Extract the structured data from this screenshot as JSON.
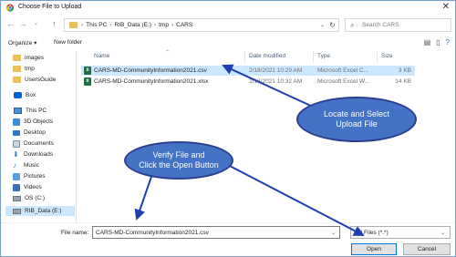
{
  "window": {
    "title": "Choose File to Upload",
    "close_glyph": "✕"
  },
  "address": {
    "crumbs": [
      "This PC",
      "RIB_Data (E:)",
      "tmp",
      "CARS"
    ],
    "separator": "›",
    "search_placeholder": "Search CARS"
  },
  "toolbar": {
    "organize_label": "Organize ▾",
    "new_folder_label": "New folder"
  },
  "nav": {
    "items": [
      {
        "label": "images",
        "icon": "folder-icon"
      },
      {
        "label": "tmp",
        "icon": "folder-icon"
      },
      {
        "label": "UsersGuide",
        "icon": "folder-icon"
      },
      {
        "label": "Box",
        "icon": "box-icon"
      },
      {
        "label": "This PC",
        "icon": "computer-icon"
      },
      {
        "label": "3D Objects",
        "icon": "3d-objects-icon"
      },
      {
        "label": "Desktop",
        "icon": "desktop-icon"
      },
      {
        "label": "Documents",
        "icon": "documents-icon"
      },
      {
        "label": "Downloads",
        "icon": "downloads-icon"
      },
      {
        "label": "Music",
        "icon": "music-icon"
      },
      {
        "label": "Pictures",
        "icon": "pictures-icon"
      },
      {
        "label": "Videos",
        "icon": "videos-icon"
      },
      {
        "label": "OS (C:)",
        "icon": "drive-icon"
      },
      {
        "label": "RIB_Data (E:)",
        "icon": "drive-icon"
      }
    ]
  },
  "files": {
    "columns": [
      "Name",
      "Date modified",
      "Type",
      "Size"
    ],
    "rows": [
      {
        "name": "CARS-MD-CommunityInformation2021.csv",
        "date": "2/18/2021 10:29 AM",
        "type": "Microsoft Excel C...",
        "size": "3 KB"
      },
      {
        "name": "CARS-MD-CommunityInformation2021.xlsx",
        "date": "2/18/2021 10:32 AM",
        "type": "Microsoft Excel W...",
        "size": "14 KB"
      }
    ]
  },
  "bottom": {
    "file_name_label": "File name:",
    "file_name_value": "CARS-MD-CommunityInformation2021.csv",
    "file_type_value": "All Files (*.*)",
    "open_label": "Open",
    "cancel_label": "Cancel"
  },
  "annotations": {
    "locate_line1": "Locate and Select",
    "locate_line2": "Upload File",
    "verify_line1": "Verify File and",
    "verify_line2": "Click the Open Button",
    "callout_color": "#4472c4",
    "arrow_color": "#1f3fb0"
  },
  "colors": {
    "selection": "#cce8ff",
    "excel_green": "#1d7044",
    "folder": "#e8c259"
  }
}
